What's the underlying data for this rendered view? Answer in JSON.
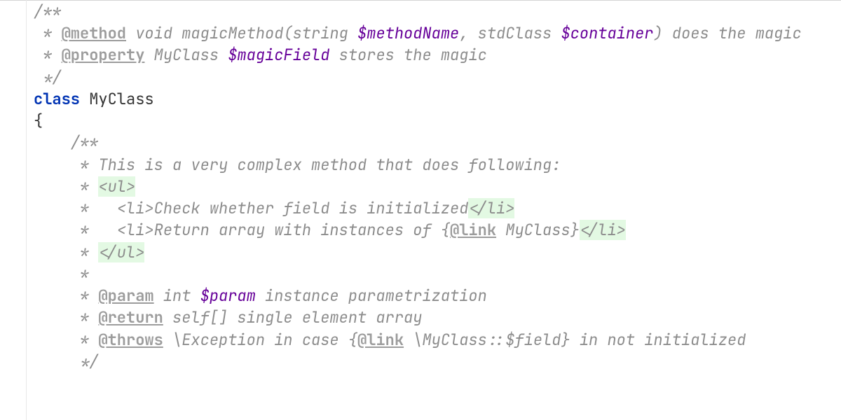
{
  "code": {
    "comment_open": "/**",
    "l1_star": " * ",
    "l1_tag": "@method",
    "l1_ret": " void",
    "l1_funcname": " magicMethod",
    "l1_paren_open": "(",
    "l1_p1_type": "string ",
    "l1_p1_name": "$methodName",
    "l1_comma": ", ",
    "l1_p2_type": "stdClass ",
    "l1_p2_name": "$container",
    "l1_paren_close": ")",
    "l1_desc": " does the magic",
    "l2_star": " * ",
    "l2_tag": "@property",
    "l2_type": " MyClass ",
    "l2_var": "$magicField",
    "l2_desc": " stores the magic",
    "comment_close": " */",
    "class_kw": "class ",
    "class_name": "MyClass",
    "brace_open": "{",
    "m_open": "    /**",
    "m_star5": "     * ",
    "m_desc": "This is a very complex method that does following:",
    "m_ul_open": "<ul>",
    "m_li_open": "<li>",
    "m_li1_text": "Check whether field is initialized",
    "m_li_close": "</li>",
    "m_li2_pre": "Return array with instances of {",
    "m_link_tag": "@link",
    "m_link_target1": " MyClass",
    "m_li2_post": "}",
    "m_ul_close": "</ul>",
    "m_blank_star": "     *",
    "m_param_tag": "@param",
    "m_param_type": " int ",
    "m_param_var": "$param",
    "m_param_desc": " instance parametrization",
    "m_return_tag": "@return",
    "m_return_type": " self[]",
    "m_return_desc": " single element array",
    "m_throws_tag": "@throws",
    "m_throws_type": " \\Exception",
    "m_throws_desc1": " in case {",
    "m_throws_link": "@link",
    "m_throws_target": " \\MyClass::$field",
    "m_throws_desc2": "} in not initialized",
    "m_close": "     */"
  }
}
